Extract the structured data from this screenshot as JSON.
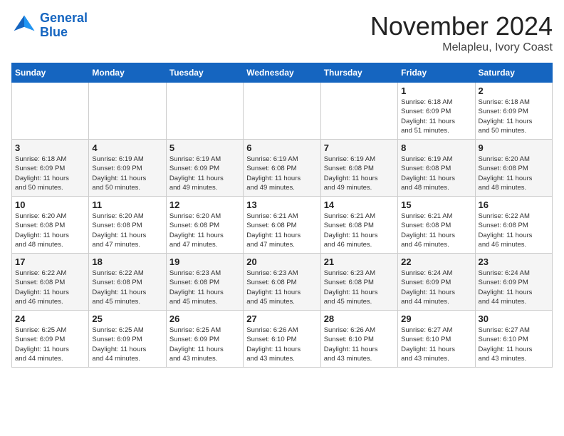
{
  "logo": {
    "line1": "General",
    "line2": "Blue"
  },
  "title": "November 2024",
  "location": "Melapleu, Ivory Coast",
  "days_of_week": [
    "Sunday",
    "Monday",
    "Tuesday",
    "Wednesday",
    "Thursday",
    "Friday",
    "Saturday"
  ],
  "weeks": [
    [
      {
        "day": "",
        "info": ""
      },
      {
        "day": "",
        "info": ""
      },
      {
        "day": "",
        "info": ""
      },
      {
        "day": "",
        "info": ""
      },
      {
        "day": "",
        "info": ""
      },
      {
        "day": "1",
        "info": "Sunrise: 6:18 AM\nSunset: 6:09 PM\nDaylight: 11 hours\nand 51 minutes."
      },
      {
        "day": "2",
        "info": "Sunrise: 6:18 AM\nSunset: 6:09 PM\nDaylight: 11 hours\nand 50 minutes."
      }
    ],
    [
      {
        "day": "3",
        "info": "Sunrise: 6:18 AM\nSunset: 6:09 PM\nDaylight: 11 hours\nand 50 minutes."
      },
      {
        "day": "4",
        "info": "Sunrise: 6:19 AM\nSunset: 6:09 PM\nDaylight: 11 hours\nand 50 minutes."
      },
      {
        "day": "5",
        "info": "Sunrise: 6:19 AM\nSunset: 6:09 PM\nDaylight: 11 hours\nand 49 minutes."
      },
      {
        "day": "6",
        "info": "Sunrise: 6:19 AM\nSunset: 6:08 PM\nDaylight: 11 hours\nand 49 minutes."
      },
      {
        "day": "7",
        "info": "Sunrise: 6:19 AM\nSunset: 6:08 PM\nDaylight: 11 hours\nand 49 minutes."
      },
      {
        "day": "8",
        "info": "Sunrise: 6:19 AM\nSunset: 6:08 PM\nDaylight: 11 hours\nand 48 minutes."
      },
      {
        "day": "9",
        "info": "Sunrise: 6:20 AM\nSunset: 6:08 PM\nDaylight: 11 hours\nand 48 minutes."
      }
    ],
    [
      {
        "day": "10",
        "info": "Sunrise: 6:20 AM\nSunset: 6:08 PM\nDaylight: 11 hours\nand 48 minutes."
      },
      {
        "day": "11",
        "info": "Sunrise: 6:20 AM\nSunset: 6:08 PM\nDaylight: 11 hours\nand 47 minutes."
      },
      {
        "day": "12",
        "info": "Sunrise: 6:20 AM\nSunset: 6:08 PM\nDaylight: 11 hours\nand 47 minutes."
      },
      {
        "day": "13",
        "info": "Sunrise: 6:21 AM\nSunset: 6:08 PM\nDaylight: 11 hours\nand 47 minutes."
      },
      {
        "day": "14",
        "info": "Sunrise: 6:21 AM\nSunset: 6:08 PM\nDaylight: 11 hours\nand 46 minutes."
      },
      {
        "day": "15",
        "info": "Sunrise: 6:21 AM\nSunset: 6:08 PM\nDaylight: 11 hours\nand 46 minutes."
      },
      {
        "day": "16",
        "info": "Sunrise: 6:22 AM\nSunset: 6:08 PM\nDaylight: 11 hours\nand 46 minutes."
      }
    ],
    [
      {
        "day": "17",
        "info": "Sunrise: 6:22 AM\nSunset: 6:08 PM\nDaylight: 11 hours\nand 46 minutes."
      },
      {
        "day": "18",
        "info": "Sunrise: 6:22 AM\nSunset: 6:08 PM\nDaylight: 11 hours\nand 45 minutes."
      },
      {
        "day": "19",
        "info": "Sunrise: 6:23 AM\nSunset: 6:08 PM\nDaylight: 11 hours\nand 45 minutes."
      },
      {
        "day": "20",
        "info": "Sunrise: 6:23 AM\nSunset: 6:08 PM\nDaylight: 11 hours\nand 45 minutes."
      },
      {
        "day": "21",
        "info": "Sunrise: 6:23 AM\nSunset: 6:08 PM\nDaylight: 11 hours\nand 45 minutes."
      },
      {
        "day": "22",
        "info": "Sunrise: 6:24 AM\nSunset: 6:09 PM\nDaylight: 11 hours\nand 44 minutes."
      },
      {
        "day": "23",
        "info": "Sunrise: 6:24 AM\nSunset: 6:09 PM\nDaylight: 11 hours\nand 44 minutes."
      }
    ],
    [
      {
        "day": "24",
        "info": "Sunrise: 6:25 AM\nSunset: 6:09 PM\nDaylight: 11 hours\nand 44 minutes."
      },
      {
        "day": "25",
        "info": "Sunrise: 6:25 AM\nSunset: 6:09 PM\nDaylight: 11 hours\nand 44 minutes."
      },
      {
        "day": "26",
        "info": "Sunrise: 6:25 AM\nSunset: 6:09 PM\nDaylight: 11 hours\nand 43 minutes."
      },
      {
        "day": "27",
        "info": "Sunrise: 6:26 AM\nSunset: 6:10 PM\nDaylight: 11 hours\nand 43 minutes."
      },
      {
        "day": "28",
        "info": "Sunrise: 6:26 AM\nSunset: 6:10 PM\nDaylight: 11 hours\nand 43 minutes."
      },
      {
        "day": "29",
        "info": "Sunrise: 6:27 AM\nSunset: 6:10 PM\nDaylight: 11 hours\nand 43 minutes."
      },
      {
        "day": "30",
        "info": "Sunrise: 6:27 AM\nSunset: 6:10 PM\nDaylight: 11 hours\nand 43 minutes."
      }
    ]
  ]
}
